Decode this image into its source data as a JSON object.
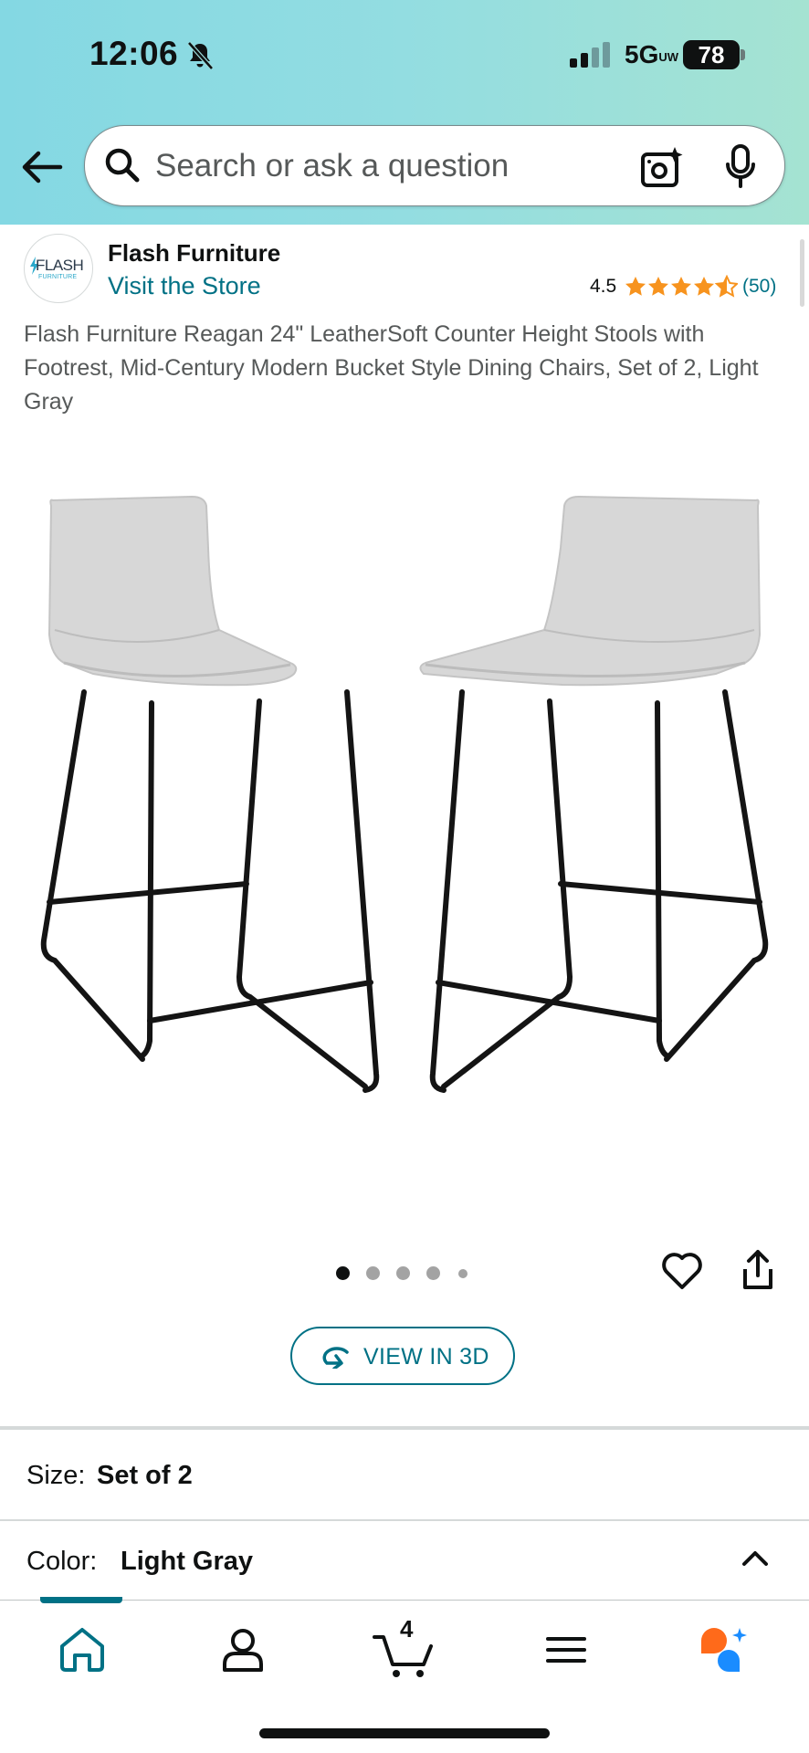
{
  "status_bar": {
    "time": "12:06",
    "network": "5G",
    "network_suffix": "UW",
    "battery": "78"
  },
  "search": {
    "placeholder": "Search or ask a question"
  },
  "brand": {
    "logo_text": "FLASH",
    "logo_subtext": "FURNITURE",
    "name": "Flash Furniture",
    "visit_store": "Visit the Store"
  },
  "rating": {
    "value": "4.5",
    "stars": 4.5,
    "count": "(50)"
  },
  "product": {
    "title": "Flash Furniture Reagan 24\" LeatherSoft Counter Height Stools with Footrest, Mid-Century Modern Bucket Style Dining Chairs, Set of 2, Light Gray",
    "image_count": 5,
    "active_image": 1
  },
  "view3d": {
    "label": "VIEW IN 3D"
  },
  "size": {
    "label": "Size:",
    "value": "Set of 2"
  },
  "color": {
    "label": "Color:",
    "value": "Light Gray"
  },
  "nav": {
    "cart_count": "4",
    "active_tab": "home"
  },
  "colors": {
    "accent": "#007185",
    "star": "#f7931e",
    "rufus_orange": "#ff6a1a",
    "rufus_blue": "#1a8cff"
  }
}
